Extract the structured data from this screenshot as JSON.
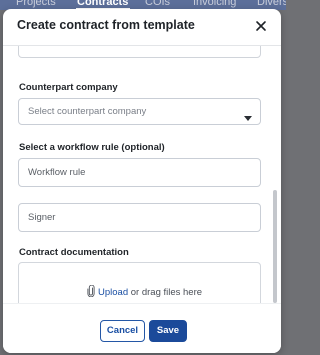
{
  "background": {
    "nav_tabs": [
      {
        "label": "Projects",
        "active": false
      },
      {
        "label": "Contracts",
        "active": true
      },
      {
        "label": "COIs",
        "active": false
      },
      {
        "label": "Invoicing",
        "active": false
      },
      {
        "label": "Diversi",
        "active": false
      }
    ],
    "colors": {
      "nav": "#5c6f9a",
      "overlay": "#6f7074"
    }
  },
  "modal": {
    "title": "Create contract from template",
    "close_icon": "close-icon",
    "counterpart": {
      "label": "Counterpart company",
      "placeholder": "Select counterpart company"
    },
    "workflow": {
      "label": "Select a workflow rule (optional)",
      "rule_placeholder": "Workflow rule",
      "signer_placeholder": "Signer"
    },
    "documentation": {
      "label": "Contract documentation",
      "upload_label": "Upload",
      "drag_text": "or drag files here",
      "icon": "paperclip-icon"
    },
    "footer": {
      "cancel_label": "Cancel",
      "save_label": "Save"
    },
    "colors": {
      "primary": "#1b4a9a",
      "link": "#1a4fa3"
    }
  }
}
